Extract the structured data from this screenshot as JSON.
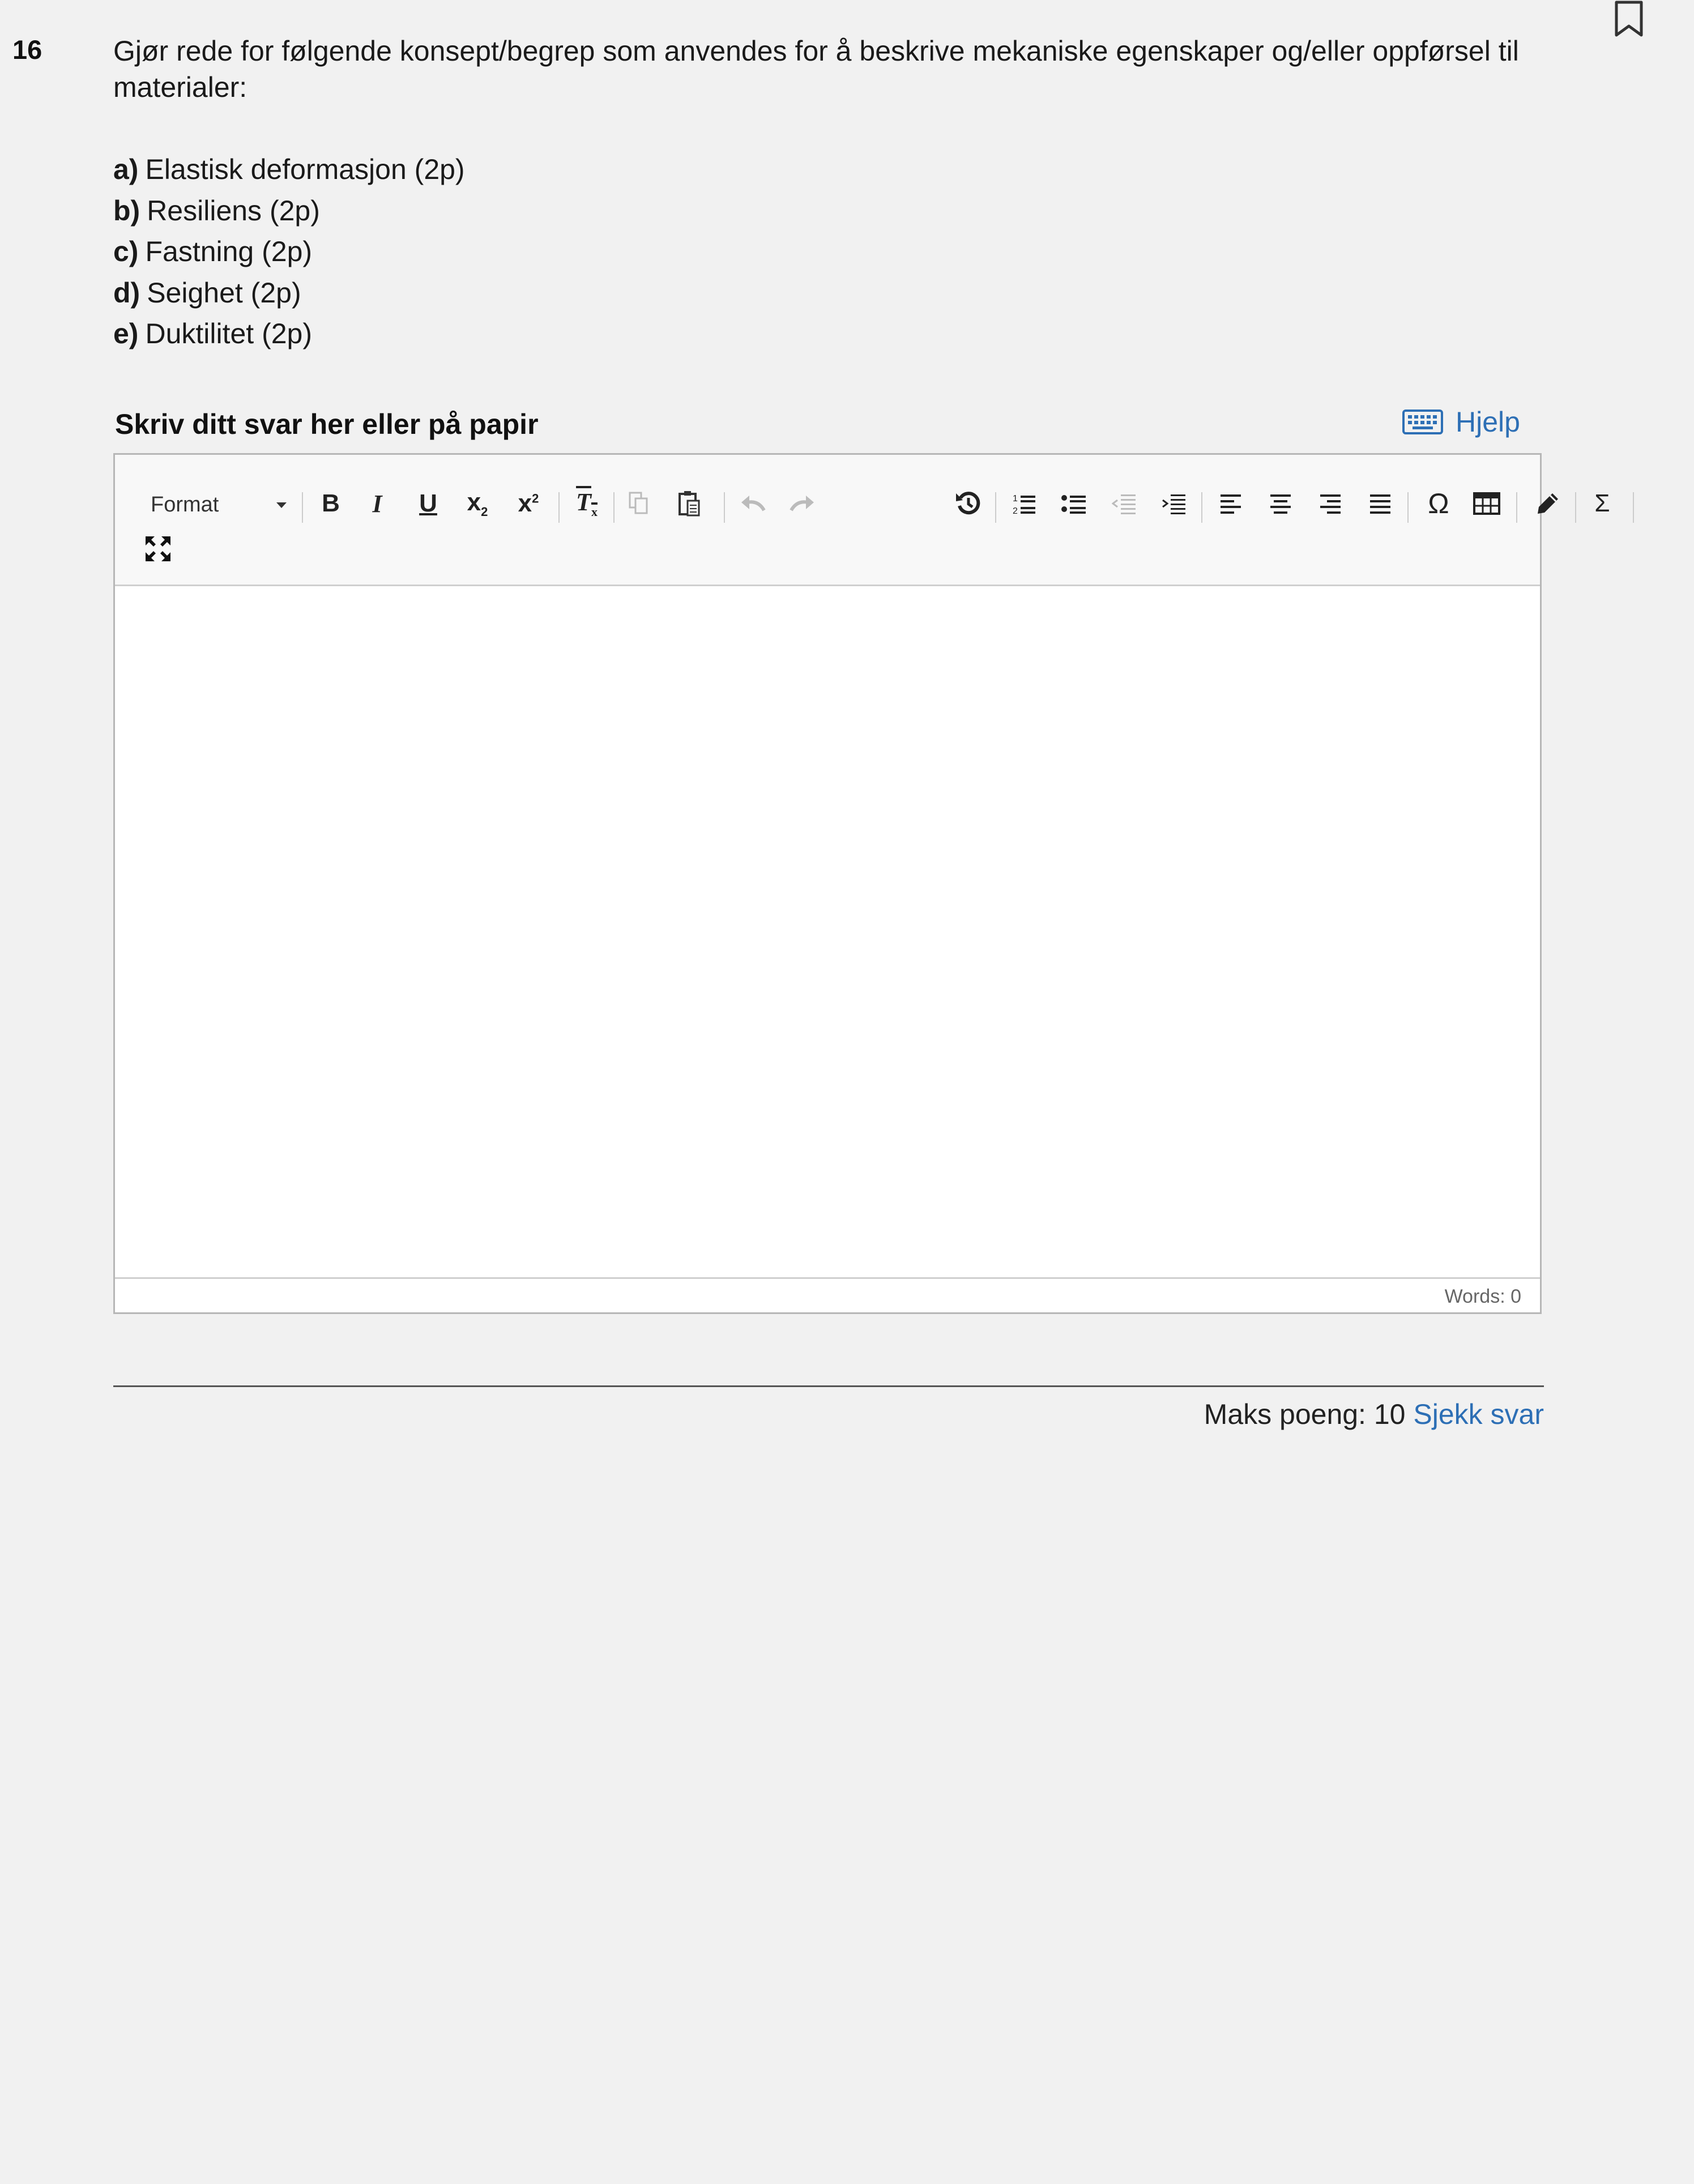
{
  "question": {
    "number": "16",
    "prompt": "Gjør rede for følgende konsept/begrep som anvendes for å beskrive mekaniske egenskaper og/eller oppførsel til materialer:",
    "items": [
      {
        "letter": "a)",
        "text": "Elastisk deformasjon (2p)"
      },
      {
        "letter": "b)",
        "text": "Resiliens (2p)"
      },
      {
        "letter": "c)",
        "text": "Fastning (2p)"
      },
      {
        "letter": "d)",
        "text": "Seighet (2p)"
      },
      {
        "letter": "e)",
        "text": "Duktilitet (2p)"
      }
    ]
  },
  "answer": {
    "label": "Skriv ditt svar her eller på papir",
    "help_label": "Hjelp"
  },
  "editor": {
    "format_label": "Format",
    "word_count": "Words: 0",
    "toolbar_icons": [
      "bold-icon",
      "italic-icon",
      "underline-icon",
      "subscript-icon",
      "superscript-icon",
      "remove-format-icon",
      "copy-icon",
      "paste-icon",
      "undo-icon",
      "redo-icon",
      "history-icon",
      "numbered-list-icon",
      "bulleted-list-icon",
      "outdent-icon",
      "indent-icon",
      "align-left-icon",
      "align-center-icon",
      "align-right-icon",
      "align-justify-icon",
      "special-character-icon",
      "table-icon",
      "draw-icon",
      "equation-icon",
      "fullscreen-icon"
    ]
  },
  "footer": {
    "max_points": "Maks poeng: 10",
    "check_label": "Sjekk svar"
  },
  "colors": {
    "link": "#2d6fb5",
    "background": "#f1f1f1"
  }
}
